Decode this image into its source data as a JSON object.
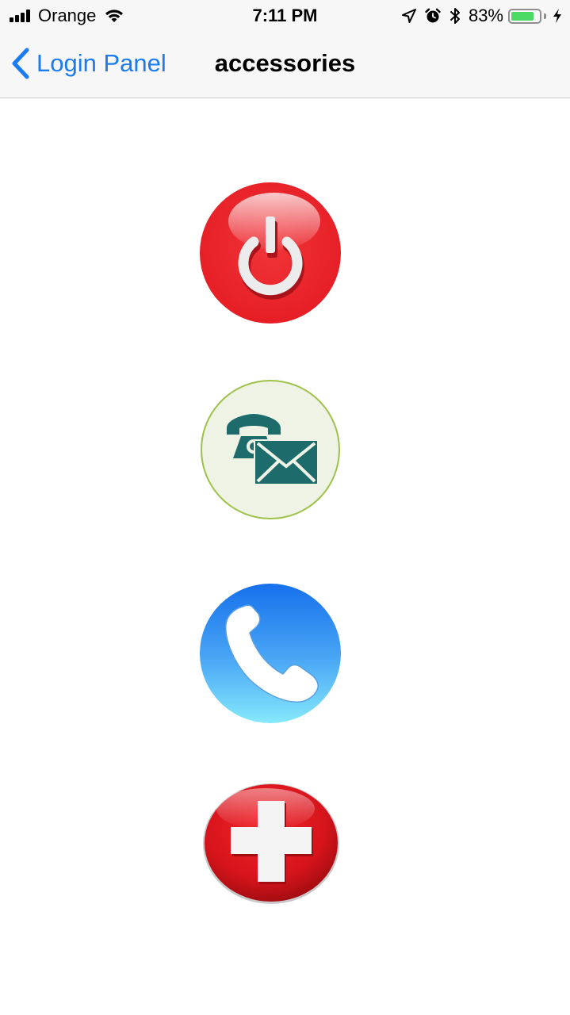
{
  "status_bar": {
    "carrier": "Orange",
    "time": "7:11 PM",
    "battery_percent": "83%",
    "battery_level": 0.83,
    "icons": [
      "signal-icon",
      "wifi-icon",
      "location-icon",
      "alarm-icon",
      "bluetooth-icon",
      "battery-icon",
      "charging-icon"
    ]
  },
  "nav": {
    "back_label": "Login Panel",
    "title": "accessories"
  },
  "actions": [
    {
      "name": "power-button",
      "icon": "power-icon",
      "color": "#e8232a"
    },
    {
      "name": "contact-button",
      "icon": "phone-mail-icon",
      "color": "#1d6b6b"
    },
    {
      "name": "call-button",
      "icon": "phone-icon",
      "color": "#2a8bf0"
    },
    {
      "name": "emergency-button",
      "icon": "medical-cross-icon",
      "color": "#d9141b"
    }
  ]
}
